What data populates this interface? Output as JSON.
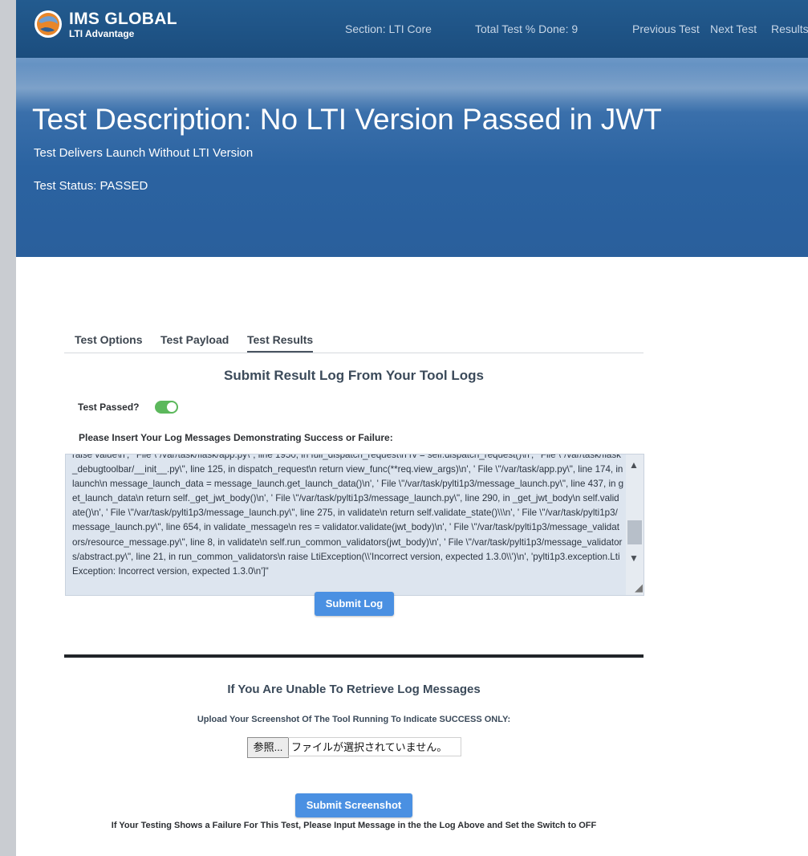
{
  "header": {
    "logo_title": "IMS GLOBAL",
    "logo_subtitle": "LTI Advantage",
    "section": "Section: LTI Core",
    "total_done": "Total Test % Done: 9",
    "nav_previous": "Previous Test",
    "nav_next": "Next Test",
    "nav_results": "Results"
  },
  "hero": {
    "title": "Test Description: No LTI Version Passed in JWT",
    "subtitle": "Test Delivers Launch Without LTI Version",
    "status": "Test Status: PASSED"
  },
  "tabs": [
    {
      "label": "Test Options",
      "active": false
    },
    {
      "label": "Test Payload",
      "active": false
    },
    {
      "label": "Test Results",
      "active": true
    }
  ],
  "result_log": {
    "title": "Submit Result Log From Your Tool Logs",
    "passed_label": "Test Passed?",
    "passed": true,
    "insert_label": "Please Insert Your Log Messages Demonstrating Success or Failure:",
    "log_text": "raise value\\n', ' File \\\"/var/task/flask/app.py\\\", line 1950, in full_dispatch_request\\n rv = self.dispatch_request()\\n', ' File \\\"/var/task/flask_debugtoolbar/__init__.py\\\", line 125, in dispatch_request\\n return view_func(**req.view_args)\\n', ' File \\\"/var/task/app.py\\\", line 174, in launch\\n message_launch_data = message_launch.get_launch_data()\\n', ' File \\\"/var/task/pylti1p3/message_launch.py\\\", line 437, in get_launch_data\\n return self._get_jwt_body()\\n', ' File \\\"/var/task/pylti1p3/message_launch.py\\\", line 290, in _get_jwt_body\\n self.validate()\\n', ' File \\\"/var/task/pylti1p3/message_launch.py\\\", line 275, in validate\\n return self.validate_state()\\\\\\n', ' File \\\"/var/task/pylti1p3/message_launch.py\\\", line 654, in validate_message\\n res = validator.validate(jwt_body)\\n', ' File \\\"/var/task/pylti1p3/message_validators/resource_message.py\\\", line 8, in validate\\n self.run_common_validators(jwt_body)\\n', ' File \\\"/var/task/pylti1p3/message_validators/abstract.py\\\", line 21, in run_common_validators\\n raise LtiException(\\\\'Incorrect version, expected 1.3.0\\\\')\\n', 'pylti1p3.exception.LtiException: Incorrect version, expected 1.3.0\\n']\"",
    "submit_label": "Submit Log"
  },
  "screenshot": {
    "title": "If You Are Unable To Retrieve Log Messages",
    "instructions": "Upload Your Screenshot Of The Tool Running To Indicate SUCCESS ONLY:",
    "browse_label": "参照...",
    "no_file_text": "ファイルが選択されていません。",
    "submit_label": "Submit Screenshot",
    "footnote": "If Your Testing Shows a Failure For This Test, Please Input Message in the the Log Above and Set the Switch to OFF"
  },
  "colors": {
    "header_blue": "#1b4d7e",
    "hero_blue": "#2a5f9c",
    "button_blue": "#4a90e2",
    "toggle_green": "#5cb85c"
  }
}
